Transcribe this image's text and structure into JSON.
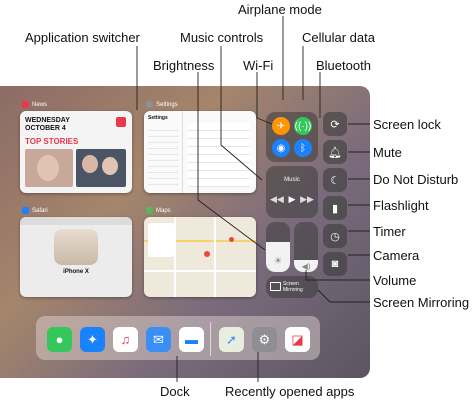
{
  "callouts": {
    "airplane_mode": "Airplane mode",
    "application_switcher": "Application switcher",
    "music_controls": "Music controls",
    "cellular_data": "Cellular data",
    "brightness": "Brightness",
    "wifi": "Wi-Fi",
    "bluetooth": "Bluetooth",
    "screen_lock": "Screen lock",
    "mute": "Mute",
    "do_not_disturb": "Do Not Disturb",
    "flashlight": "Flashlight",
    "timer": "Timer",
    "camera": "Camera",
    "volume": "Volume",
    "screen_mirroring": "Screen Mirroring",
    "dock": "Dock",
    "recently_opened_apps": "Recently opened apps"
  },
  "screen": {
    "news": {
      "app_label": "News",
      "date_line1": "WEDNESDAY",
      "date_line2": "OCTOBER 4",
      "top_stories": "TOP STORIES"
    },
    "settings": {
      "app_label": "Settings",
      "panel_title": "Settings"
    },
    "safari": {
      "app_label": "Safari",
      "product": "iPhone X"
    },
    "maps": {
      "app_label": "Maps"
    },
    "control_center": {
      "music_label": "Music",
      "screen_mirroring_label": "Screen Mirroring"
    }
  },
  "colors": {
    "airplane_tile": "#ff9500",
    "cellular_tile": "#34c759",
    "wifi_tile": "#1a82fb",
    "bluetooth_tile": "#1a82fb",
    "news_red": "#e8394a"
  },
  "dock_icons": [
    "messages-icon",
    "safari-icon",
    "music-icon",
    "mail-icon",
    "files-icon",
    "maps-icon",
    "settings-icon",
    "news-icon"
  ]
}
